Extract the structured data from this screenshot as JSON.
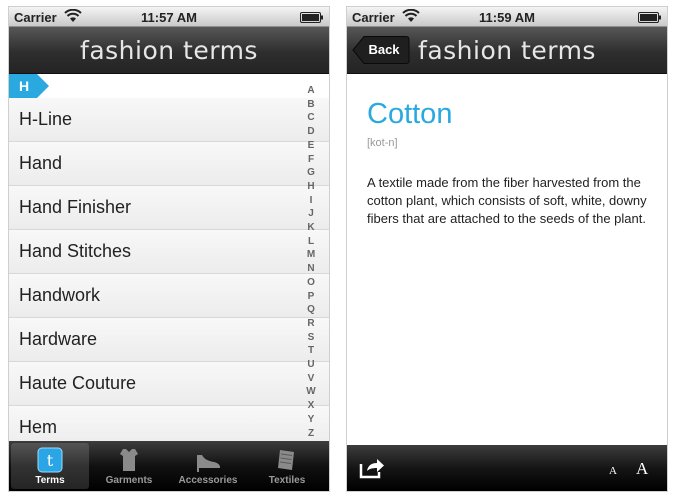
{
  "left_screen": {
    "status": {
      "carrier": "Carrier",
      "time": "11:57 AM"
    },
    "nav_title": "fashion terms",
    "section": "H",
    "terms": [
      "H-Line",
      "Hand",
      "Hand Finisher",
      "Hand Stitches",
      "Handwork",
      "Hardware",
      "Haute Couture",
      "Hem"
    ],
    "index_letters": [
      "A",
      "B",
      "C",
      "D",
      "E",
      "F",
      "G",
      "H",
      "I",
      "J",
      "K",
      "L",
      "M",
      "N",
      "O",
      "P",
      "Q",
      "R",
      "S",
      "T",
      "U",
      "V",
      "W",
      "X",
      "Y",
      "Z"
    ],
    "tabs": [
      {
        "label": "Terms",
        "icon": "terms-icon",
        "selected": true
      },
      {
        "label": "Garments",
        "icon": "garment-icon",
        "selected": false
      },
      {
        "label": "Accessories",
        "icon": "shoe-icon",
        "selected": false
      },
      {
        "label": "Textiles",
        "icon": "textile-icon",
        "selected": false
      }
    ]
  },
  "right_screen": {
    "status": {
      "carrier": "Carrier",
      "time": "11:59 AM"
    },
    "nav_title": "fashion terms",
    "back_label": "Back",
    "term": "Cotton",
    "pronunciation": "[kot-n]",
    "definition": "A textile made from the fiber harvested from the cotton plant, which consists of soft, white, downy fibers that are attached to the seeds of the plant.",
    "font_small": "A",
    "font_large": "A"
  },
  "colors": {
    "accent": "#29a9e0",
    "bar_dark": "#2e2e2e"
  }
}
